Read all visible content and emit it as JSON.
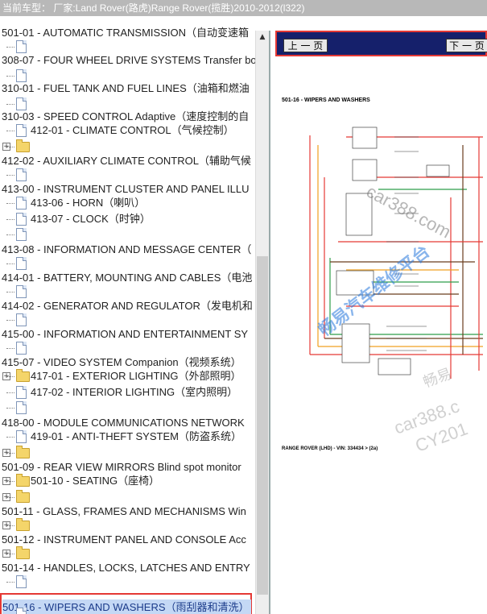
{
  "title": "当前车型： 厂家:Land Rover(路虎)Range Rover(揽胜)2010-2012(l322)",
  "tree_items": [
    "501-01 - AUTOMATIC TRANSMISSION（自动变速箱",
    "308-07 - FOUR WHEEL DRIVE SYSTEMS Transfer bo",
    "310-01 - FUEL TANK AND FUEL LINES（油箱和燃油",
    "310-03 - SPEED CONTROL Adaptive（速度控制的自",
    "412-01 - CLIMATE CONTROL（气候控制）",
    "412-02 - AUXILIARY CLIMATE CONTROL（辅助气候",
    "413-00 - INSTRUMENT CLUSTER AND PANEL ILLU",
    "413-06 - HORN（喇叭）",
    "413-07 - CLOCK（时钟）",
    "413-08 - INFORMATION AND MESSAGE CENTER（",
    "414-01 - BATTERY, MOUNTING AND CABLES（电池",
    "414-02 - GENERATOR AND REGULATOR（发电机和",
    "415-00 - INFORMATION AND ENTERTAINMENT SY",
    "415-07 - VIDEO SYSTEM Companion（视频系统）",
    "417-01 - EXTERIOR LIGHTING（外部照明）",
    "417-02 - INTERIOR LIGHTING（室内照明）",
    "418-00 - MODULE COMMUNICATIONS NETWORK",
    "419-01 - ANTI-THEFT SYSTEM（防盗系统）",
    "501-09 - REAR VIEW MIRRORS Blind spot monitor",
    "501-10 - SEATING（座椅）",
    "501-11 - GLASS, FRAMES AND MECHANISMS Win",
    "501-12 - INSTRUMENT PANEL AND CONSOLE Acc",
    "501-14 - HANDLES, LOCKS, LATCHES AND ENTRY",
    "501-16 - WIPERS AND WASHERS（雨刮器和清洗）"
  ],
  "nav": {
    "prev": "上 一 页",
    "next": "下 一 页"
  },
  "document": {
    "title": "501-16 - WIPERS AND WASHERS",
    "footer": "RANGE ROVER (LHD) - VIN: 334434 > (2a)"
  },
  "watermarks": [
    "car388.com",
    "畅易汽车维修平台",
    "畅易",
    "car388.c",
    "CY201"
  ]
}
